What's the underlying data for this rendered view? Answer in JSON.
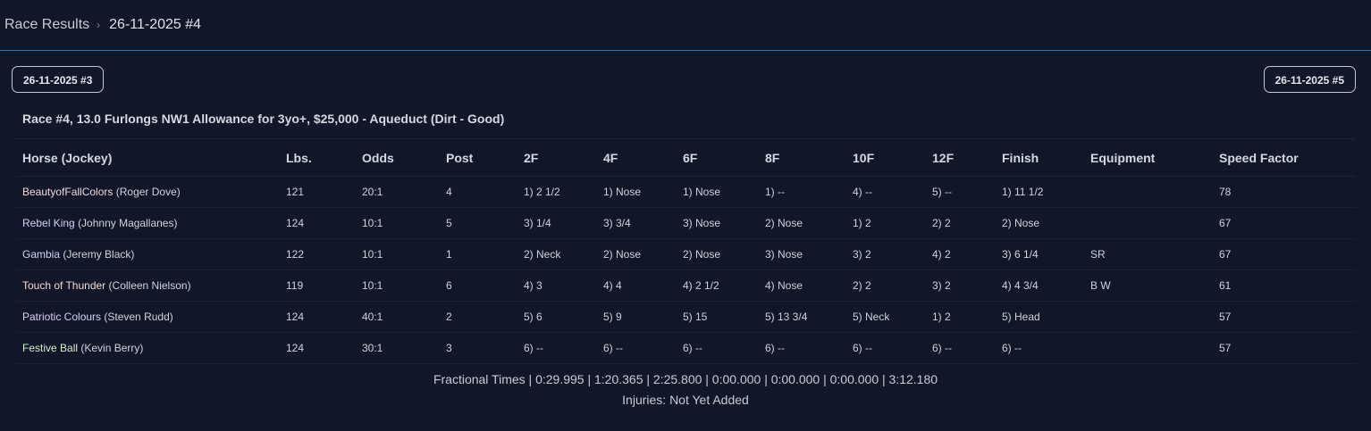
{
  "breadcrumb": {
    "root": "Race Results",
    "separator": "›",
    "current": "26-11-2025 #4"
  },
  "nav": {
    "prev_label": "26-11-2025 #3",
    "next_label": "26-11-2025 #5"
  },
  "race_title": "Race #4, 13.0 Furlongs NW1 Allowance for 3yo+, $25,000 - Aqueduct (Dirt - Good)",
  "table": {
    "headers": [
      "Horse (Jockey)",
      "Lbs.",
      "Odds",
      "Post",
      "2F",
      "4F",
      "6F",
      "8F",
      "10F",
      "12F",
      "Finish",
      "Equipment",
      "Speed Factor"
    ],
    "rows": [
      {
        "horse": "BeautyofFallColors",
        "horse_color": "#f3d9d9",
        "jockey": "(Roger Dove)",
        "lbs": "121",
        "odds": "20:1",
        "post": "4",
        "f2": "1) 2 1/2",
        "f4": "1) Nose",
        "f6": "1) Nose",
        "f8": "1) --",
        "f10": "4) --",
        "f12": "5) --",
        "finish": "1) 11 1/2",
        "equipment": "",
        "speed": "78"
      },
      {
        "horse": "Rebel King",
        "horse_color": "#d6d2f5",
        "jockey": "(Johnny Magallanes)",
        "lbs": "124",
        "odds": "10:1",
        "post": "5",
        "f2": "3) 1/4",
        "f4": "3) 3/4",
        "f6": "3) Nose",
        "f8": "2) Nose",
        "f10": "1) 2",
        "f12": "2) 2",
        "finish": "2) Nose",
        "equipment": "",
        "speed": "67"
      },
      {
        "horse": "Gambia",
        "horse_color": "#d6d2f5",
        "jockey": "(Jeremy Black)",
        "lbs": "122",
        "odds": "10:1",
        "post": "1",
        "f2": "2) Neck",
        "f4": "2) Nose",
        "f6": "2) Nose",
        "f8": "3) Nose",
        "f10": "3) 2",
        "f12": "4) 2",
        "finish": "3) 6 1/4",
        "equipment": "SR",
        "speed": "67"
      },
      {
        "horse": "Touch of Thunder",
        "horse_color": "#f3dcd0",
        "jockey": "(Colleen Nielson)",
        "lbs": "119",
        "odds": "10:1",
        "post": "6",
        "f2": "4) 3",
        "f4": "4) 4",
        "f6": "4) 2 1/2",
        "f8": "4) Nose",
        "f10": "2) 2",
        "f12": "3) 2",
        "finish": "4) 4 3/4",
        "equipment": "B W",
        "speed": "61"
      },
      {
        "horse": "Patriotic Colours",
        "horse_color": "#d6d2f5",
        "jockey": "(Steven Rudd)",
        "lbs": "124",
        "odds": "40:1",
        "post": "2",
        "f2": "5) 6",
        "f4": "5) 9",
        "f6": "5) 15",
        "f8": "5) 13 3/4",
        "f10": "5) Neck",
        "f12": "1) 2",
        "finish": "5) Head",
        "equipment": "",
        "speed": "57"
      },
      {
        "horse": "Festive Ball",
        "horse_color": "#d4f0c9",
        "jockey": "(Kevin Berry)",
        "lbs": "124",
        "odds": "30:1",
        "post": "3",
        "f2": "6) --",
        "f4": "6) --",
        "f6": "6) --",
        "f8": "6) --",
        "f10": "6) --",
        "f12": "6) --",
        "finish": "6) --",
        "equipment": "",
        "speed": "57"
      }
    ]
  },
  "fractional_times": "Fractional Times | 0:29.995 | 1:20.365 | 2:25.800 | 0:00.000 | 0:00.000 | 0:00.000 | 3:12.180",
  "injuries": "Injuries: Not Yet Added"
}
